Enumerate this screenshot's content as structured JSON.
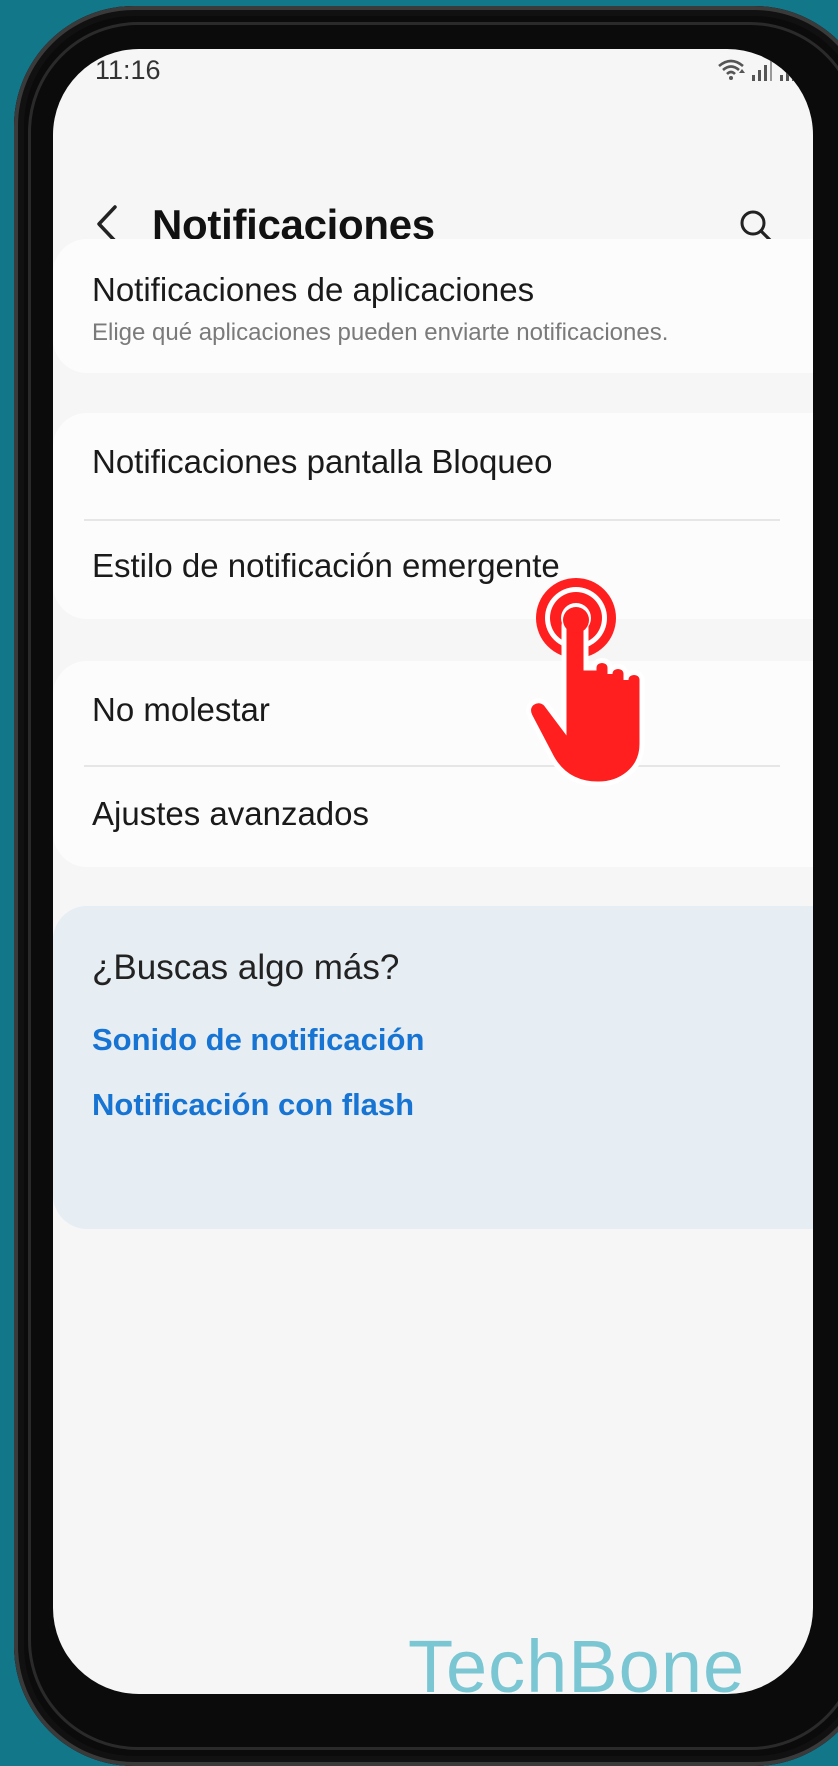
{
  "status_bar": {
    "time": "11:16",
    "icons": [
      "wifi-icon",
      "signal-icon",
      "signal-icon",
      "battery-icon"
    ]
  },
  "header": {
    "title": "Notificaciones",
    "back_icon": "chevron-left-icon",
    "search_icon": "search-icon"
  },
  "sections": {
    "app_notifications": {
      "title": "Notificaciones de aplicaciones",
      "subtitle": "Elige qué aplicaciones pueden enviarte notificaciones."
    },
    "lock_screen": "Notificaciones pantalla Bloqueo",
    "popup_style": "Estilo de notificación emergente",
    "do_not_disturb": "No molestar",
    "advanced": "Ajustes avanzados"
  },
  "suggestions": {
    "title": "¿Buscas algo más?",
    "links": [
      "Sonido de notificación",
      "Notificación con flash"
    ]
  },
  "watermark": "TechBone",
  "colors": {
    "background": "#13778a",
    "screen": "#f6f6f6",
    "card": "#fcfcfc",
    "suggest_card": "#e6eef4",
    "link": "#1774d3",
    "tap_indicator": "#ff1f1f",
    "watermark": "#6dc1d0"
  }
}
